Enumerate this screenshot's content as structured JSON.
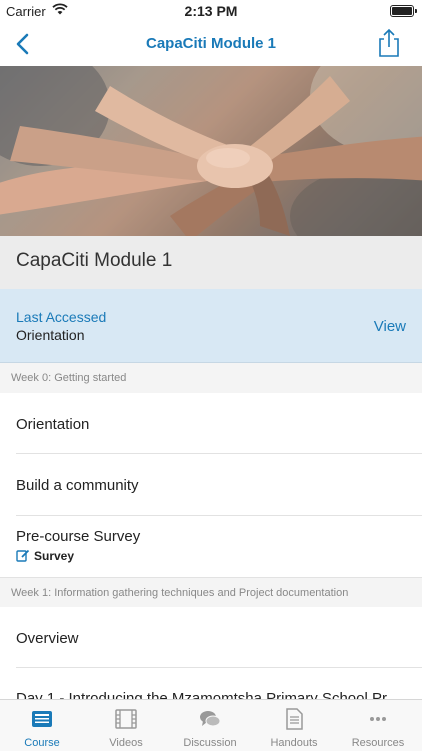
{
  "status_bar": {
    "carrier": "Carrier",
    "time": "2:13 PM"
  },
  "nav": {
    "title": "CapaCiti Module 1"
  },
  "course": {
    "title": "CapaCiti Module 1"
  },
  "last_accessed": {
    "label": "Last Accessed",
    "value": "Orientation",
    "action": "View"
  },
  "sections": [
    {
      "header": "Week 0: Getting started",
      "items": [
        {
          "title": "Orientation"
        },
        {
          "title": "Build a community"
        },
        {
          "title": "Pre-course Survey",
          "subtitle": "Survey"
        }
      ]
    },
    {
      "header": "Week 1: Information gathering techniques and Project documentation",
      "items": [
        {
          "title": "Overview"
        },
        {
          "title": "Day 1 - Introducing the Mzamomtsha Primary School Pr"
        }
      ]
    }
  ],
  "tabs": [
    {
      "label": "Course",
      "icon": "course-icon"
    },
    {
      "label": "Videos",
      "icon": "film-icon"
    },
    {
      "label": "Discussion",
      "icon": "chat-bubbles-icon"
    },
    {
      "label": "Handouts",
      "icon": "document-icon"
    },
    {
      "label": "Resources",
      "icon": "more-dots-icon"
    }
  ],
  "colors": {
    "accent": "#1a7ab8",
    "highlight_bg": "#d8e8f4",
    "tab_inactive": "#888888"
  }
}
